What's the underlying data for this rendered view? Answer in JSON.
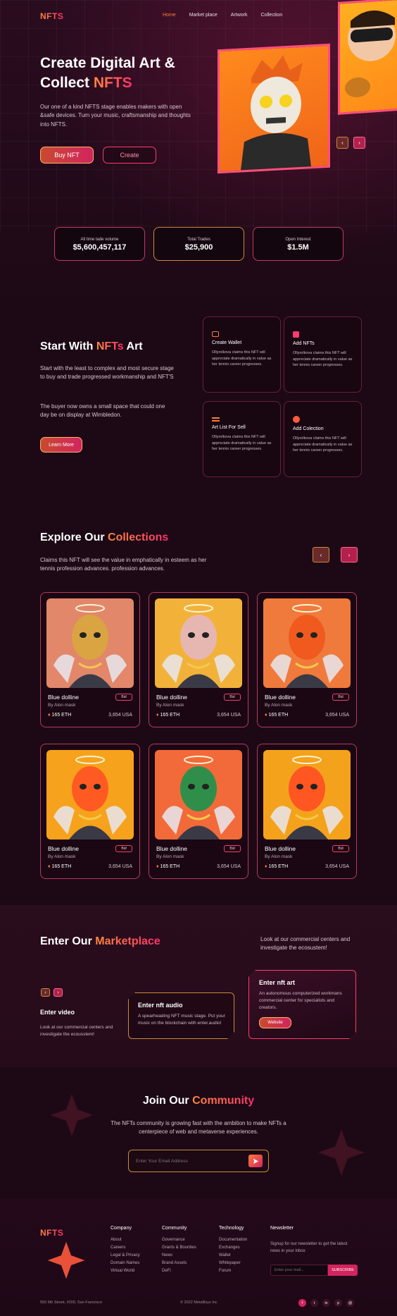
{
  "brand": {
    "logo": "NFTS"
  },
  "nav": [
    {
      "label": "Home",
      "active": true
    },
    {
      "label": "Market place",
      "active": false
    },
    {
      "label": "Artwork",
      "active": false
    },
    {
      "label": "Collection",
      "active": false
    }
  ],
  "hero": {
    "title_line1": "Create Digital Art &",
    "title_line2_plain": "Collect ",
    "title_line2_accent": "NFTS",
    "desc": "Our one of a kind NFTS stage enables makers with open &safe devices. Turn your music, craftsmanship and thoughts into NFTS.",
    "buy_label": "Buy NFT",
    "create_label": "Create",
    "prev_icon": "chevron-left-icon",
    "next_icon": "chevron-right-icon"
  },
  "stats": [
    {
      "label": "All time tade volume",
      "value": "$5,600,457,117"
    },
    {
      "label": "Total Trades",
      "value": "$25,900"
    },
    {
      "label": "Open Interest",
      "value": "$1.5M"
    }
  ],
  "start": {
    "title_plain": "Start With ",
    "title_accent": "NFTs",
    "title_end": " Art",
    "p1": "Start with the  least to complex and most secure stage to buy and trade progressed workmanship and NFT'S",
    "p2": "The buyer now owns a small space that could one day be on display at Wimbledon.",
    "cta": "Learn More",
    "cards": [
      {
        "title": "Create Wallet",
        "icon": "wallet-icon",
        "text": "Ollyrolkova claims this NFT will appreciate dramatically in value as her tennis career progresses."
      },
      {
        "title": "Add NFTs",
        "icon": "image-icon",
        "text": "Ollyrolkova claims this NFT will appreciate dramatically in value as her tennis career progresses."
      },
      {
        "title": "Art List For Sell",
        "icon": "list-icon",
        "text": "Ollyrolkova claims this NFT will appreciate dramatically in value as her tennis career progresses."
      },
      {
        "title": "Add Colection",
        "icon": "collection-icon",
        "text": "Ollyrolkova claims this NFT will appreciate dramatically in value as her tennis career progresses."
      }
    ]
  },
  "collections": {
    "title_plain": "Explore Our ",
    "title_accent": "Collections",
    "desc": "Claims this NFT will see the value in emphatically in esteem as her tennis profession advances. profession advances.",
    "items": [
      {
        "name": "Blue dolline",
        "author": "By Alon mask",
        "price": "165 ETH",
        "usd": "3,654 USA",
        "bid": "Bid",
        "bg": "#e2876a",
        "mask": "#d9a441"
      },
      {
        "name": "Blue dolline",
        "author": "By Alon mask",
        "price": "165 ETH",
        "usd": "3,654 USA",
        "bid": "Bid",
        "bg": "#f2b23a",
        "mask": "#e6b7b0"
      },
      {
        "name": "Blue dolline",
        "author": "By Alon mask",
        "price": "165 ETH",
        "usd": "3,654 USA",
        "bid": "Bid",
        "bg": "#f07a3c",
        "mask": "#f05a1e"
      },
      {
        "name": "Blue dolline",
        "author": "By Alon mask",
        "price": "165 ETH",
        "usd": "3,654 USA",
        "bid": "Bid",
        "bg": "#f7a21c",
        "mask": "#ff5a22"
      },
      {
        "name": "Blue dolline",
        "author": "By Alon mask",
        "price": "165 ETH",
        "usd": "3,654 USA",
        "bid": "Bid",
        "bg": "#f26a3a",
        "mask": "#2f8f4a"
      },
      {
        "name": "Blue dolline",
        "author": "By Alon mask",
        "price": "165 ETH",
        "usd": "3,654 USA",
        "bid": "Bid",
        "bg": "#f4a21c",
        "mask": "#ff5622"
      }
    ]
  },
  "marketplace": {
    "title_plain": "Enter Our ",
    "title_accent": "Marketplace",
    "side_text": "Look at our commercial centers and investigate the ecosustem!",
    "video_title": "Enter video",
    "video_text": "Look at our commercial centers and investigate the ecousstem!",
    "audio_title": "Enter nft audio",
    "audio_text": "A spearheading NFT music stage. Put your music on the blockchain with enter.audio!",
    "art_title": "Enter nft art",
    "art_text": "An autonomous computerized workmans commercial center for specialists and creators.",
    "website_label": "Website"
  },
  "community": {
    "title_plain": "Join Our ",
    "title_accent": "Community",
    "desc": "The NFTs community is growing fast with the ambition to make NFTs a centerpiece of web and metaverse experiences.",
    "email_placeholder": "Enter Your Email Address",
    "send_icon": "send-icon"
  },
  "footer": {
    "logo": "NFTS",
    "columns": [
      {
        "title": "Company",
        "links": [
          "About",
          "Careers",
          "Legal & Privacy",
          "Domain Names",
          "Virtual World"
        ]
      },
      {
        "title": "Community",
        "links": [
          "Governance",
          "Grants & Bounties",
          "News",
          "Brand Assets",
          "DeFi"
        ]
      },
      {
        "title": "Technology",
        "links": [
          "Documentation",
          "Exchanges",
          "Wallet",
          "Whitepaper",
          "Forum"
        ]
      }
    ],
    "newsletter_title": "Newsletter",
    "newsletter_text": "Signup for our newsletter to get the latest news in your inbox",
    "newsletter_placeholder": "Enter your mail...",
    "subscribe_label": "SUBSCRIBE",
    "address": "550 6th Street, #200, San Francisco",
    "copyright": "© 2022 MetaBoys Inc",
    "social": [
      "f",
      "t",
      "in",
      "p",
      "@"
    ]
  }
}
